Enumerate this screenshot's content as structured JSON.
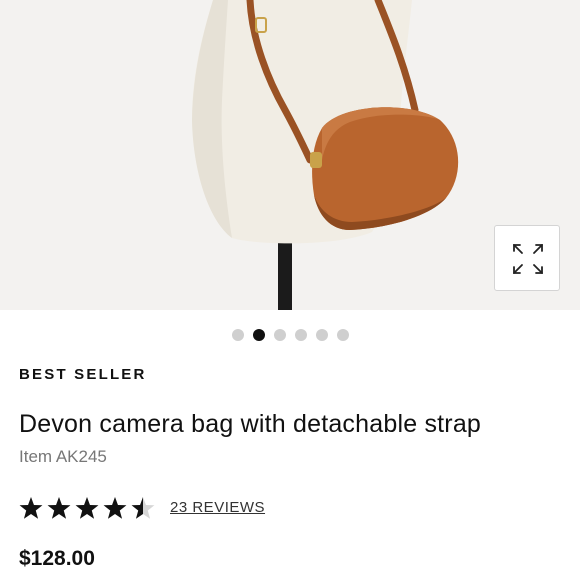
{
  "gallery": {
    "image_alt": "Devon camera bag on mannequin",
    "dot_count": 6,
    "active_dot": 1
  },
  "icons": {
    "expand": "expand-arrows-icon",
    "star": "star-icon"
  },
  "product": {
    "badge": "BEST SELLER",
    "title": "Devon camera bag with detachable strap",
    "item_code": "Item AK245",
    "rating": 4.5,
    "rating_max": 5,
    "reviews_label": "23 REVIEWS",
    "price": "$128.00"
  },
  "colors": {
    "bag": "#b9652e",
    "background": "#f3f2f0",
    "active_dot": "#111111",
    "inactive_dot": "#cfcfcf"
  }
}
